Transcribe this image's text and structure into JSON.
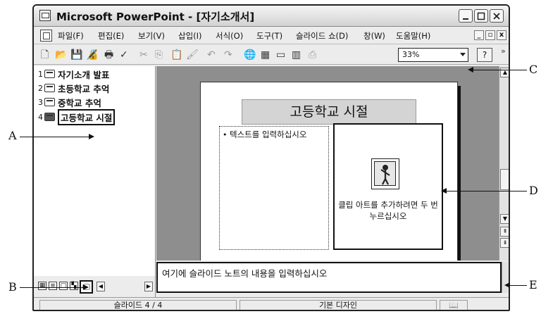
{
  "window": {
    "title": "Microsoft PowerPoint - [자기소개서]"
  },
  "menubar": {
    "items": [
      "파일(F)",
      "편집(E)",
      "보기(V)",
      "삽입(I)",
      "서식(O)",
      "도구(T)",
      "슬라이드 쇼(D)",
      "창(W)",
      "도움말(H)"
    ],
    "mdi_buttons": [
      "_",
      "▫",
      "x"
    ]
  },
  "toolbar": {
    "zoom_value": "33%",
    "help_label": "?",
    "more_label": "»"
  },
  "outline": {
    "items": [
      {
        "number": "1",
        "label": "자기소개 발표"
      },
      {
        "number": "2",
        "label": "초등학교 추억"
      },
      {
        "number": "3",
        "label": "중학교 추억"
      },
      {
        "number": "4",
        "label": "고등학교 시절"
      }
    ]
  },
  "slide": {
    "title": "고등학교 시절",
    "text_placeholder": "텍스트를 입력하십시오",
    "clipart_placeholder": "클립 아트를 추가하려면 두 번 누르십시오"
  },
  "notes": {
    "text": "여기에 슬라이드 노트의 내용을 입력하십시오"
  },
  "statusbar": {
    "slide_position": "슬라이드 4 / 4",
    "design": "기본 디자인"
  },
  "callouts": {
    "a": "A",
    "b": "B",
    "c": "C",
    "d": "D",
    "e": "E"
  }
}
